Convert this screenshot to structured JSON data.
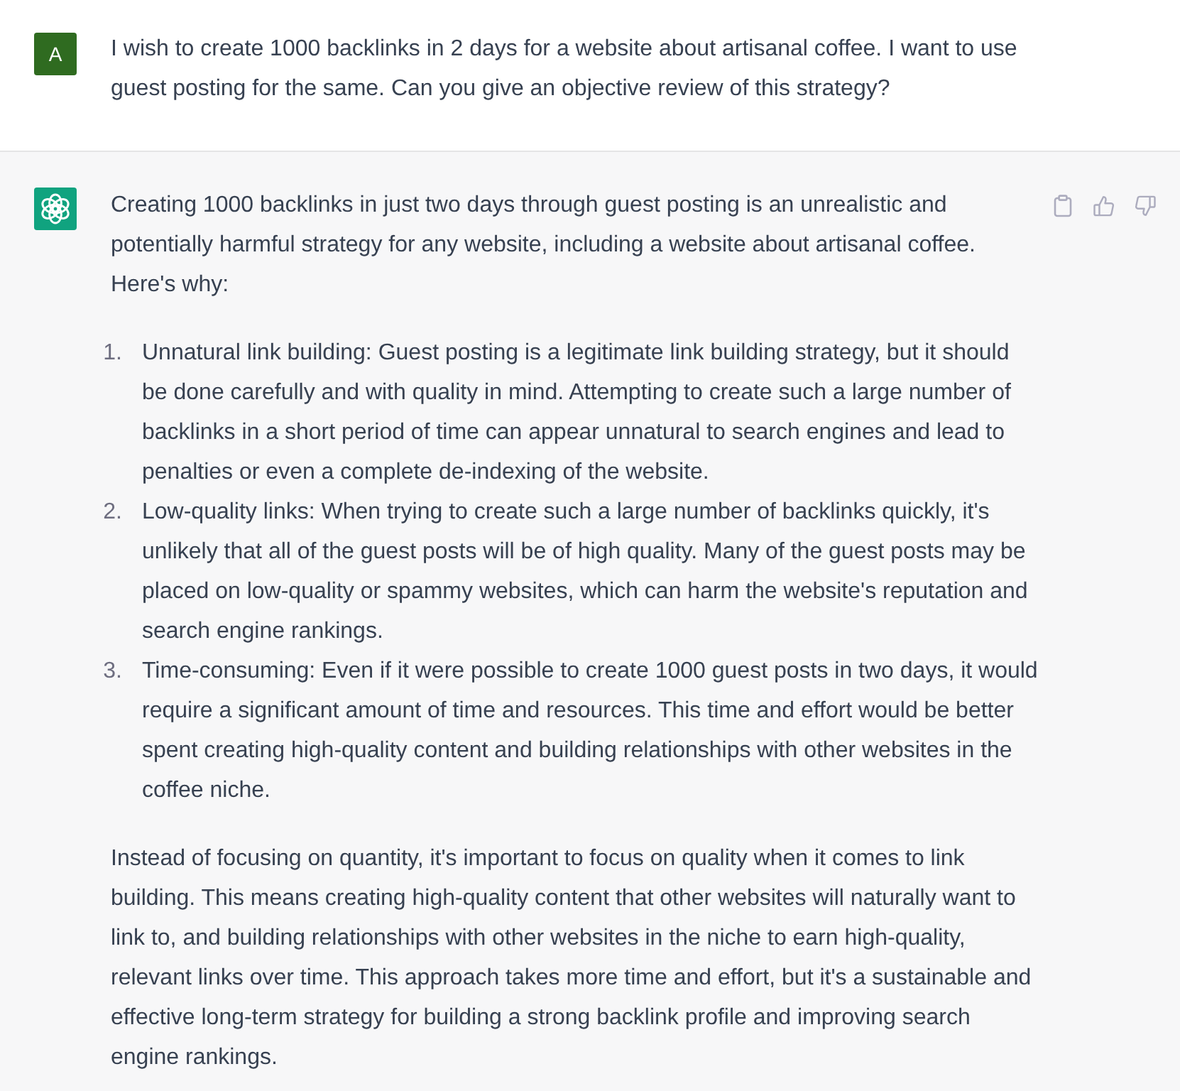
{
  "user_message": {
    "avatar_letter": "A",
    "text": "I wish to create 1000 backlinks in 2 days for a website about artisanal coffee. I want to use guest posting for the same. Can you give an objective review of this strategy?"
  },
  "assistant_message": {
    "blocks": [
      {
        "kind": "paragraph",
        "text": "Creating 1000 backlinks in just two days through guest posting is an unrealistic and potentially harmful strategy for any website, including a website about artisanal coffee. Here's why:"
      },
      {
        "kind": "list",
        "items": [
          {
            "number": "1.",
            "text": "Unnatural link building: Guest posting is a legitimate link building strategy, but it should be done carefully and with quality in mind. Attempting to create such a large number of backlinks in a short period of time can appear unnatural to search engines and lead to penalties or even a complete de-indexing of the website."
          },
          {
            "number": "2.",
            "text": "Low-quality links: When trying to create such a large number of backlinks quickly, it's unlikely that all of the guest posts will be of high quality. Many of the guest posts may be placed on low-quality or spammy websites, which can harm the website's reputation and search engine rankings."
          },
          {
            "number": "3.",
            "text": "Time-consuming: Even if it were possible to create 1000 guest posts in two days, it would require a significant amount of time and resources. This time and effort would be better spent creating high-quality content and building relationships with other websites in the coffee niche."
          }
        ]
      },
      {
        "kind": "paragraph",
        "text": "Instead of focusing on quantity, it's important to focus on quality when it comes to link building. This means creating high-quality content that other websites will naturally want to link to, and building relationships with other websites in the niche to earn high-quality, relevant links over time. This approach takes more time and effort, but it's a sustainable and effective long-term strategy for building a strong backlink profile and improving search engine rankings."
      }
    ]
  }
}
